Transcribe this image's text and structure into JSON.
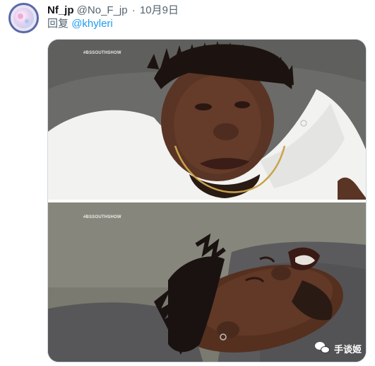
{
  "tweet": {
    "display_name": "Nf_jp",
    "handle": "@No_F_jp",
    "separator": "·",
    "date": "10月9日",
    "reply_prefix": "回复",
    "reply_to": "@khyleri"
  },
  "media": {
    "watermark_top": "#BSSOUTHSHOW",
    "watermark_bottom": "#BSSOUTHSHOW"
  },
  "overlay_badge": {
    "text": "手谈姬",
    "icon": "wechat-icon"
  },
  "colors": {
    "text_primary": "#0f1419",
    "text_secondary": "#536471",
    "link": "#1d9bf0",
    "border": "#cfd9de"
  }
}
